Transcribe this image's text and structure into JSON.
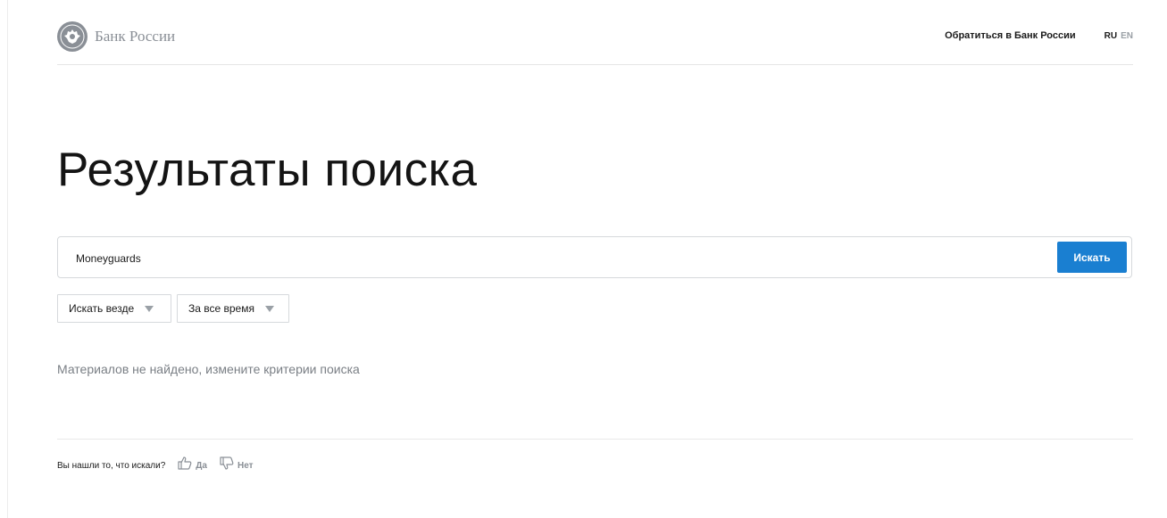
{
  "header": {
    "brand_name": "Банк России",
    "contact_link": "Обратиться в Банк России",
    "languages": [
      {
        "code": "RU",
        "active": true
      },
      {
        "code": "EN",
        "active": false
      }
    ]
  },
  "page_title": "Результаты поиска",
  "search": {
    "value": "Moneyguards",
    "button_label": "Искать"
  },
  "filters": {
    "scope": "Искать везде",
    "period": "За все время"
  },
  "results": {
    "empty_message": "Материалов не найдено, измените критерии поиска"
  },
  "feedback": {
    "question": "Вы нашли то, что искали?",
    "yes": "Да",
    "no": "Нет"
  },
  "colors": {
    "accent": "#1a7fd1",
    "muted": "#8a8f96"
  }
}
